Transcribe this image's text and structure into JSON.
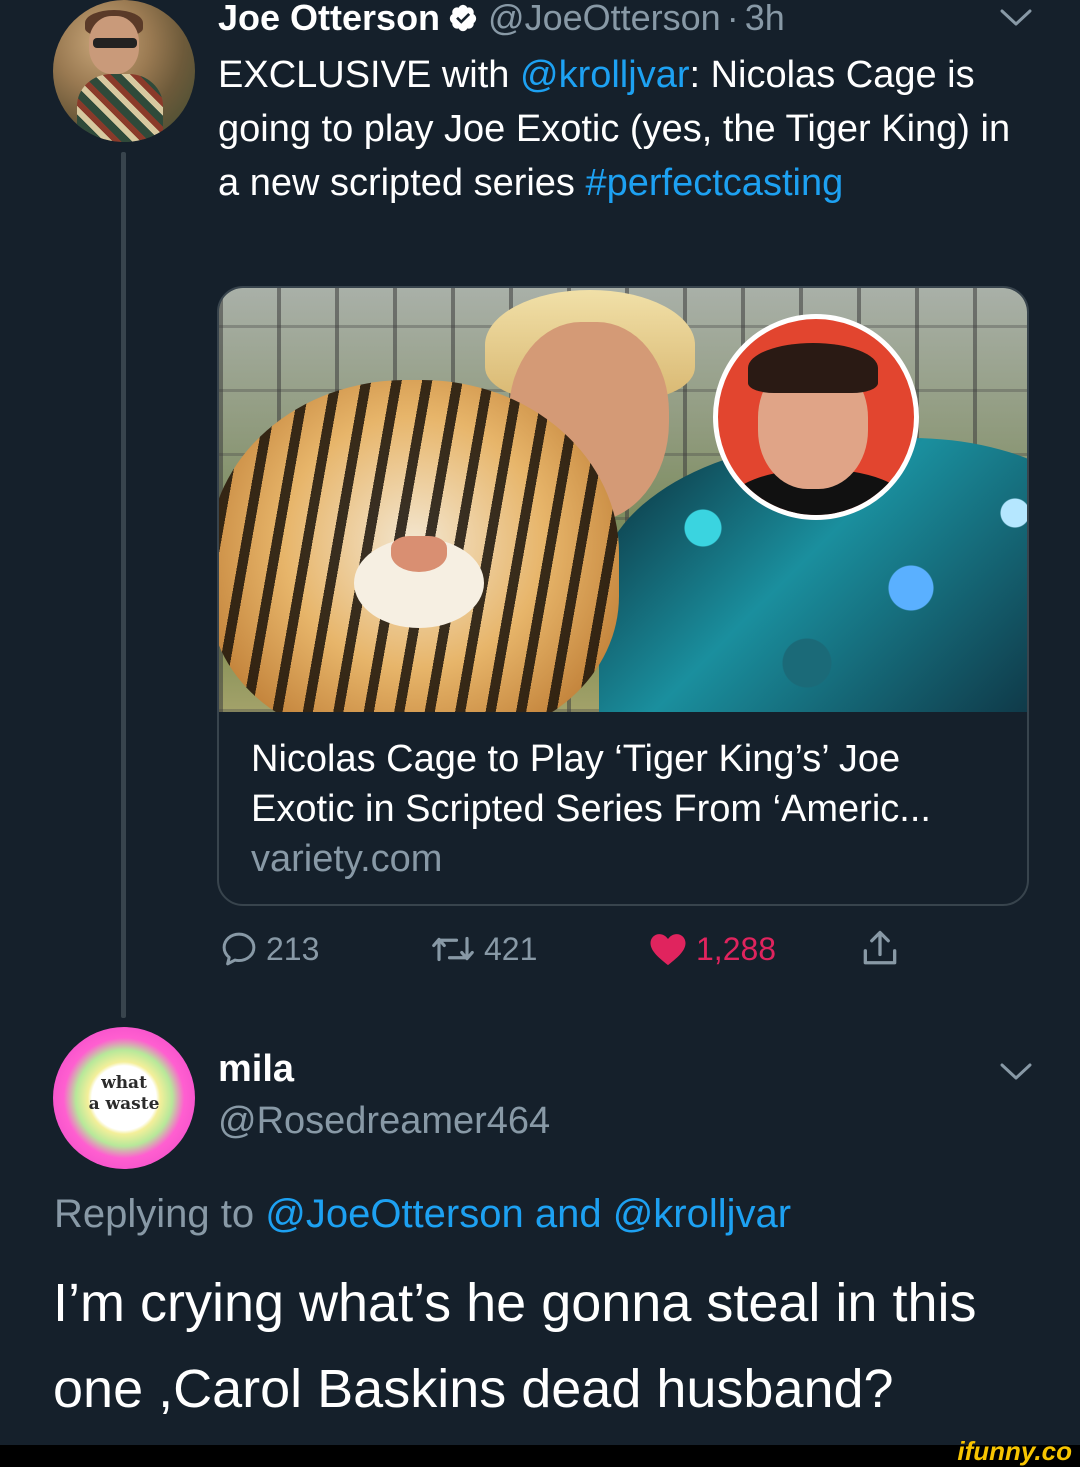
{
  "tweet": {
    "author_name": "Joe Otterson",
    "author_handle": "@JoeOtterson",
    "separator": "·",
    "time": "3h",
    "body": {
      "part1": "EXCLUSIVE with ",
      "mention": "@krolljvar",
      "part2": ": Nicolas Cage is going to play Joe Exotic (yes, the Tiger King) in a new scripted series ",
      "hashtag": "#perfectcasting"
    },
    "card": {
      "title": "Nicolas Cage to Play ‘Tiger King’s’ Joe Exotic in Scripted Series From ‘Americ...",
      "domain": "variety.com"
    },
    "actions": {
      "replies": "213",
      "retweets": "421",
      "likes": "1,288"
    }
  },
  "reply": {
    "author_name": "mila",
    "author_handle": "@Rosedreamer464",
    "avatar_text_line1": "what",
    "avatar_text_line2": "a waste",
    "replying_prefix": "Replying to ",
    "replying_to": "@JoeOtterson and @krolljvar",
    "text": "I’m crying  what’s he gonna steal in this one ,Carol Baskins dead husband?"
  },
  "watermark": "ifunny.co",
  "icons": {
    "verified": "verified-badge-icon",
    "chevron": "chevron-down-icon",
    "reply": "reply-icon",
    "retweet": "retweet-icon",
    "like": "heart-icon",
    "share": "share-icon"
  },
  "colors": {
    "background": "#15202b",
    "link": "#1da1f2",
    "secondary_text": "#8899a6",
    "like": "#e0245e",
    "border": "#38444d"
  }
}
